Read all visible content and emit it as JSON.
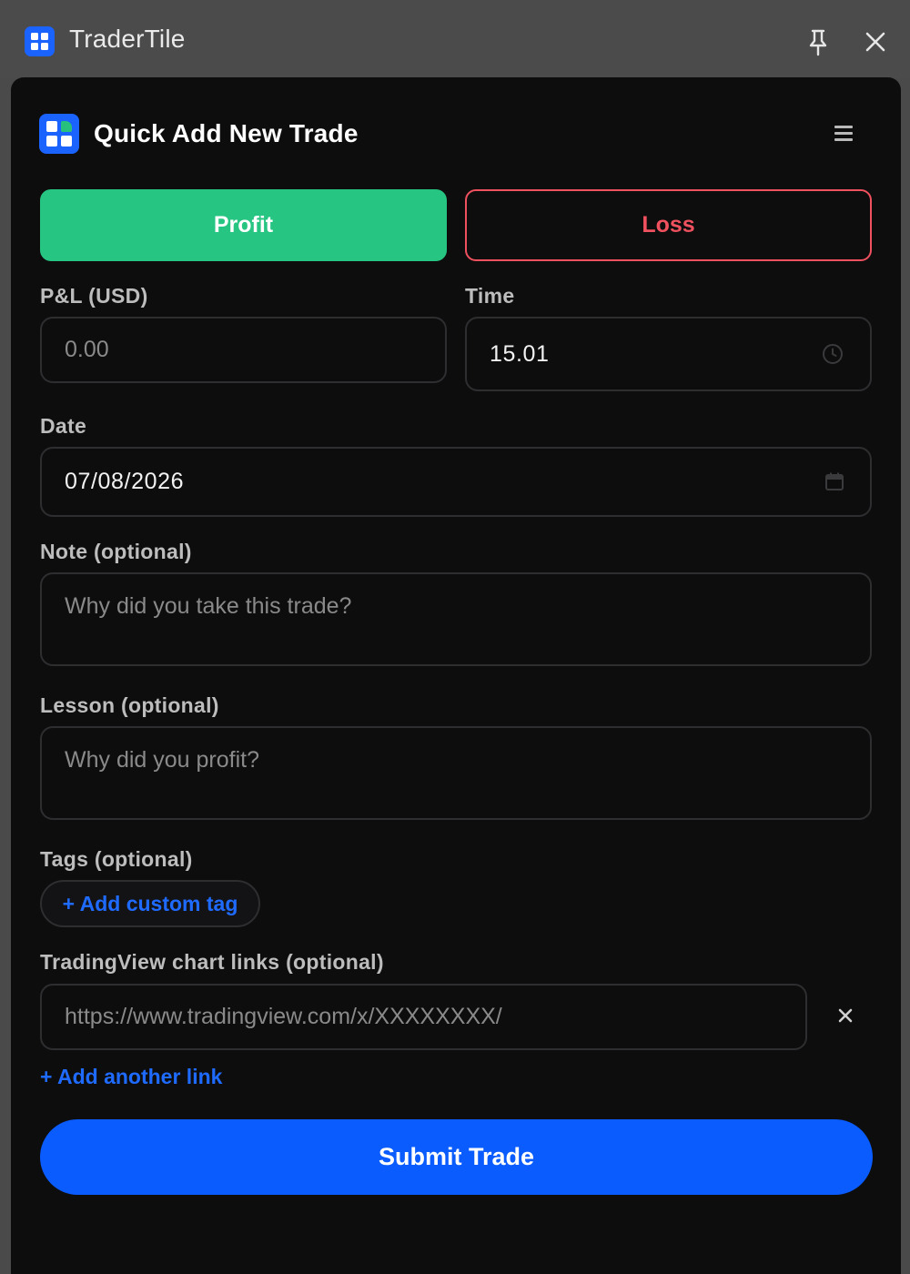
{
  "window": {
    "title": "TraderTile",
    "icons": {
      "app": "app-grid-icon",
      "pin": "pin-icon",
      "close": "close-icon"
    }
  },
  "header": {
    "title": "Quick Add New Trade",
    "logo": "app-logo-icon",
    "menu_icon": "menu-icon"
  },
  "type_toggle": {
    "profit_label": "Profit",
    "loss_label": "Loss",
    "selected": "Profit",
    "colors": {
      "profit": "#27c582",
      "loss": "#f0515e"
    }
  },
  "pnl": {
    "label": "P&L (USD)",
    "placeholder": "0.00",
    "value": ""
  },
  "time": {
    "label": "Time",
    "value": "15.01",
    "icon": "clock-icon"
  },
  "date": {
    "label": "Date",
    "value": "07/08/2026",
    "icon": "calendar-icon"
  },
  "note": {
    "label": "Note (optional)",
    "placeholder": "Why did you take this trade?"
  },
  "lesson": {
    "label": "Lesson (optional)",
    "placeholder": "Why did you profit?"
  },
  "tags": {
    "label": "Tags (optional)",
    "add_label": "+ Add custom tag"
  },
  "links": {
    "label": "TradingView chart links (optional)",
    "placeholder": "https://www.tradingview.com/x/XXXXXXXX/",
    "remove_icon": "x-icon",
    "add_label": "+ Add another link"
  },
  "submit_label": "Submit Trade",
  "colors": {
    "accent": "#0a5cff",
    "panel_bg": "#0d0d0e",
    "titlebar_bg": "#4b4b4b"
  }
}
